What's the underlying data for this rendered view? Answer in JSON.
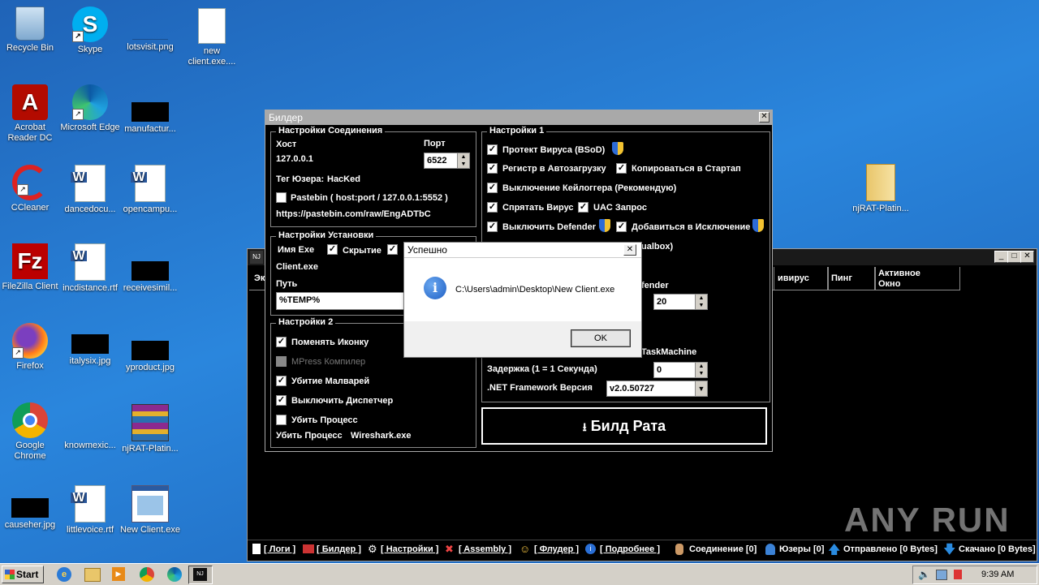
{
  "desktop": {
    "icons": [
      {
        "label": "Recycle Bin"
      },
      {
        "label": "Skype"
      },
      {
        "label": "lotsvisit.png"
      },
      {
        "label": "new client.exe...."
      },
      {
        "label": "Acrobat Reader DC"
      },
      {
        "label": "Microsoft Edge"
      },
      {
        "label": "manufactur..."
      },
      {
        "label": "CCleaner"
      },
      {
        "label": "dancedocu..."
      },
      {
        "label": "opencampu..."
      },
      {
        "label": "FileZilla Client"
      },
      {
        "label": "incdistance.rtf"
      },
      {
        "label": "receivesimil..."
      },
      {
        "label": "Firefox"
      },
      {
        "label": "italysix.jpg"
      },
      {
        "label": "yproduct.jpg"
      },
      {
        "label": "Google Chrome"
      },
      {
        "label": "knowmexic..."
      },
      {
        "label": "njRAT-Platin..."
      },
      {
        "label": "causeher.jpg"
      },
      {
        "label": "littlevoice.rtf"
      },
      {
        "label": "New Client.exe"
      },
      {
        "label": "njRAT-Platin..."
      }
    ]
  },
  "main_window": {
    "columns": [
      "Эк",
      "ивирус",
      "Пинг",
      "Активное Окно"
    ],
    "bottom_bar": {
      "logs": "[ Логи ]",
      "builder": "[ Билдер ]",
      "settings": "[ Настройки ]",
      "assembly": "[ Assembly ]",
      "flooder": "[ Флудер ]",
      "more": "[ Подробнее ]",
      "connection": "Соединение [0]",
      "users": "Юзеры [0]",
      "sent": "Отправлено [0 Bytes]",
      "downloaded": "Скачано [0 Bytes]"
    }
  },
  "builder": {
    "title": "Билдер",
    "conn": {
      "group": "Настройки Соединения",
      "host_label": "Хост",
      "host_value": "127.0.0.1",
      "port_label": "Порт",
      "port_value": "6522",
      "tag_label": "Тег Юзера:",
      "tag_value": "HacKed",
      "pastebin_label": "Pastebin ( host:port / 127.0.0.1:5552  )",
      "pastebin_url": "https://pastebin.com/raw/EngADTbC"
    },
    "install": {
      "group": "Настройки Установки",
      "exe_label": "Имя Exe",
      "hide_label": "Скрытие",
      "exe_value": "Client.exe",
      "path_label": "Путь",
      "path_value": "%TEMP%"
    },
    "s2": {
      "group": "Настройки 2",
      "change_icon": "Поменять Иконку",
      "mpress": "MPress Компилер",
      "kill_malware": "Убитие Малварей",
      "disable_taskmgr": "Выключить Диспетчер",
      "kill_process": "Убить Процесс",
      "kill_process_label": "Убить Процесс",
      "kill_process_value": "Wireshark.exe"
    },
    "s1": {
      "group": "Настройки 1",
      "protect": "Протект Вируса (BSoD)",
      "registry": "Регистр в Автозагрузку",
      "copy_startup": "Копироваться в Стартап",
      "keylogger": "Выключение Кейлоггера (Рекомендую)",
      "hide_virus": "Спрятать Вирус",
      "uac": "UAC Запрос",
      "defender": "Выключить Defender",
      "exclusion": "Добавиться в Исключение",
      "vbox_partial": "ualbox)",
      "defender_partial": "fender",
      "value_20": "20",
      "taskmachine_partial": "TaskMachine",
      "delay_label": "Задержка (1 = 1 Секунда)",
      "delay_value": "0",
      "net_label": ".NET Framework Версия",
      "net_value": "v2.0.50727"
    },
    "build_button": "Билд Рата"
  },
  "dialog": {
    "title": "Успешно",
    "message": "C:\\Users\\admin\\Desktop\\New Client.exe",
    "ok": "OK"
  },
  "taskbar": {
    "start": "Start",
    "time": "9:39 AM"
  },
  "watermark": "ANY RUN"
}
